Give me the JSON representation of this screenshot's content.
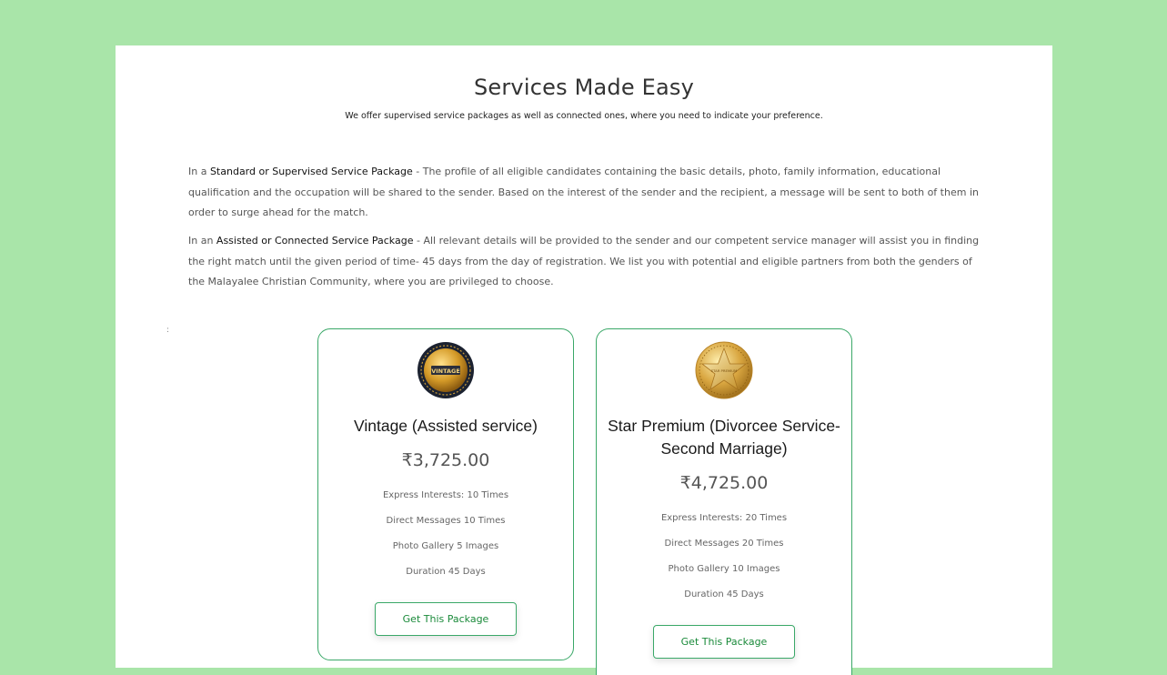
{
  "section": {
    "title": "Services Made Easy",
    "subtitle": "We offer supervised service packages as well as connected ones, where you need to indicate your preference."
  },
  "paragraphs": [
    {
      "prefix": "In a ",
      "highlight": "Standard or Supervised Service Package",
      "text": " - The profile of all eligible candidates containing the basic details, photo, family information, educational qualification and the occupation will be shared to the sender. Based on the interest of the sender and the recipient, a message will be sent to both of them in order to surge ahead for the match."
    },
    {
      "prefix": "In an ",
      "highlight": "Assisted or Connected Service Package",
      "text": " - All relevant details will be provided to the sender and our competent service manager will assist you in finding the right match until the given period of time- 45 days from the day of registration. We list you with potential and eligible partners from both the genders of the Malayalee Christian Community, where you are privileged to choose."
    }
  ],
  "stray_mark": ":",
  "packages": [
    {
      "badge_text": "VINTAGE",
      "badge_icon": "vintage-badge-icon",
      "title": "Vintage (Assisted service)",
      "price": "₹3,725.00",
      "features": [
        "Express Interests: 10 Times",
        "Direct Messages 10 Times",
        "Photo Gallery 5 Images",
        "Duration 45 Days"
      ],
      "button_label": "Get This Package"
    },
    {
      "badge_text": "STAR PREMIUM",
      "badge_icon": "star-premium-badge-icon",
      "title": "Star Premium (Divorcee Service-Second Marriage)",
      "price": "₹4,725.00",
      "features": [
        "Express Interests: 20 Times",
        "Direct Messages 20 Times",
        "Photo Gallery 10 Images",
        "Duration 45 Days"
      ],
      "button_label": "Get This Package"
    }
  ],
  "colors": {
    "page_background": "#a9e5a9",
    "accent_green": "#3aa868",
    "button_text": "#1a8a3a"
  }
}
